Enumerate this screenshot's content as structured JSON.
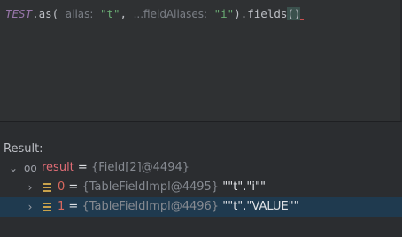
{
  "editor": {
    "code": {
      "ident": "TEST",
      "dot_as": ".as(",
      "hint_alias": "alias:",
      "arg1": "\"t\"",
      "comma": ",",
      "hint_field_aliases": "...fieldAliases:",
      "arg2": "\"i\"",
      "close_fields": ").fields",
      "parens": "()"
    }
  },
  "result": {
    "label": "Result:",
    "tree": [
      {
        "name": "result",
        "eq": "=",
        "value": "{Field[2]@4494}",
        "expanded": true
      },
      {
        "name": "0",
        "eq": "=",
        "value": "{TableFieldImpl@4495}",
        "text": "\"\"t\".\"i\"\"",
        "expanded": false
      },
      {
        "name": "1",
        "eq": "=",
        "value": "{TableFieldImpl@4496}",
        "text": "\"\"t\".\"VALUE\"\"",
        "expanded": false,
        "selected": true
      }
    ]
  },
  "colors": {
    "background": "#2b2d30",
    "editor_bg": "#2f3133",
    "selection": "#1f3a4f",
    "string": "#6aab73",
    "identifier": "#9876aa",
    "variable": "#e06c75"
  }
}
